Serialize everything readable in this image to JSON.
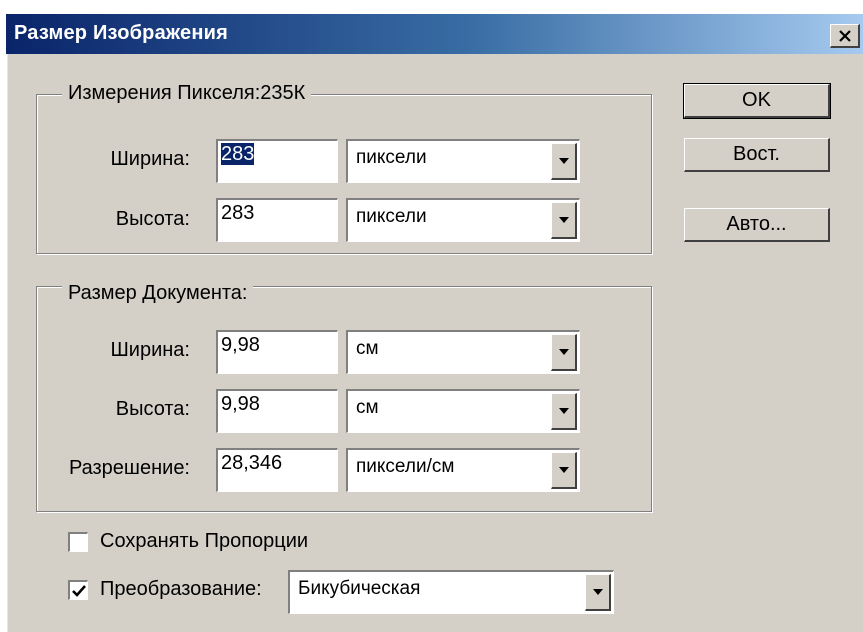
{
  "window": {
    "title": "Размер Изображения",
    "close_glyph": "×"
  },
  "pixel_dimensions": {
    "legend": "Измерения Пикселя:235К",
    "width": {
      "label": "Ширина:",
      "value": "283",
      "unit": "пиксели"
    },
    "height": {
      "label": "Высота:",
      "value": "283",
      "unit": "пиксели"
    }
  },
  "document_size": {
    "legend": "Размер Документа:",
    "width": {
      "label": "Ширина:",
      "value": "9,98",
      "unit": "см"
    },
    "height": {
      "label": "Высота:",
      "value": "9,98",
      "unit": "см"
    },
    "resolution": {
      "label": "Разрешение:",
      "value": "28,346",
      "unit": "пиксели/см"
    }
  },
  "options": {
    "constrain_proportions": {
      "label": "Сохранять Пропорции",
      "checked": false
    },
    "resample": {
      "label": "Преобразование:",
      "checked": true,
      "method": "Бикубическая"
    }
  },
  "buttons": {
    "ok": "OK",
    "reset": "Вост.",
    "auto": "Авто..."
  },
  "icons": {
    "close": "close-icon",
    "dropdown_arrow": "chevron-down-icon",
    "checkmark": "checkmark-icon"
  },
  "colors": {
    "titlebar_start": "#0a246a",
    "titlebar_end": "#a6caf0",
    "face": "#d4d0c8",
    "selection": "#0a246a"
  }
}
